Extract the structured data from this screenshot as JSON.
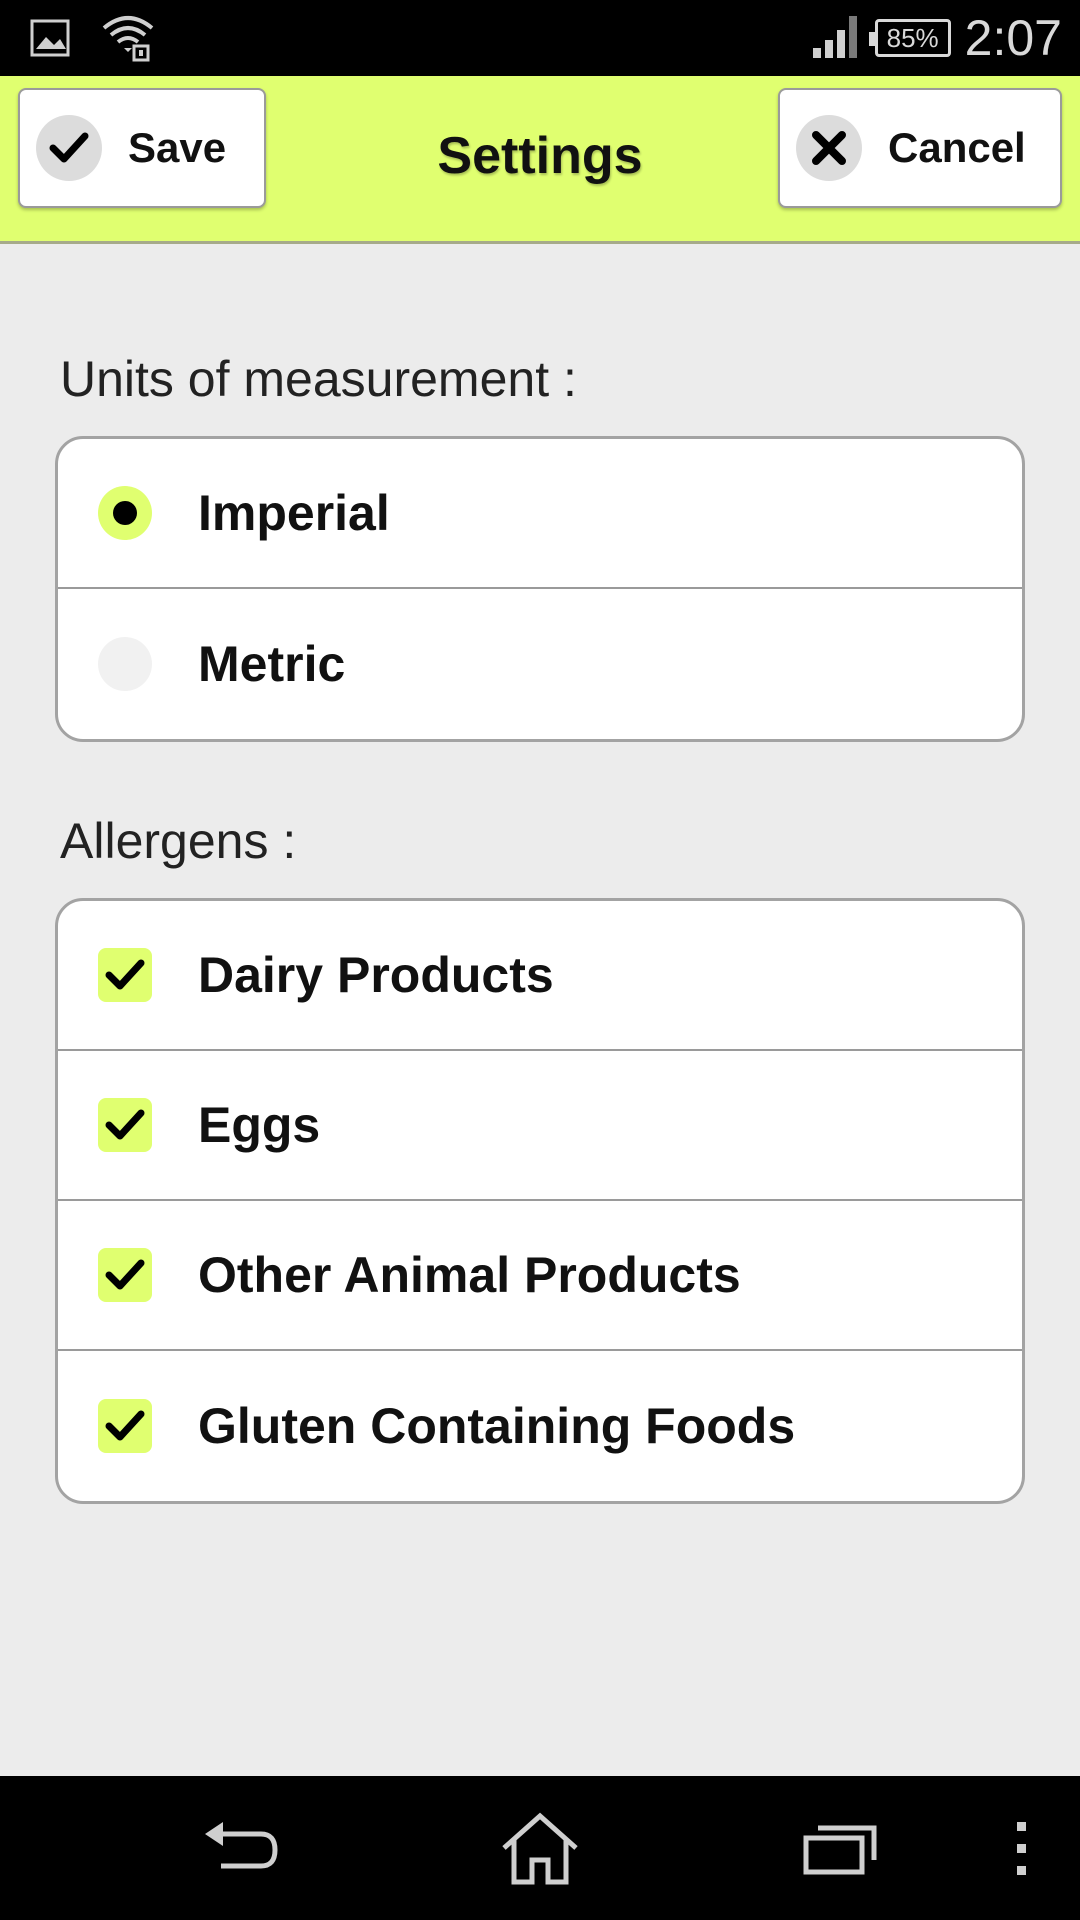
{
  "status_bar": {
    "battery": "85%",
    "time": "2:07",
    "icons": [
      "gallery-icon",
      "wifi-icon",
      "signal-icon",
      "battery-icon"
    ]
  },
  "action_bar": {
    "title": "Settings",
    "save_label": "Save",
    "cancel_label": "Cancel",
    "accent_color": "#e0ff70"
  },
  "units": {
    "label": "Units of measurement :",
    "options": [
      {
        "label": "Imperial",
        "selected": true
      },
      {
        "label": "Metric",
        "selected": false
      }
    ]
  },
  "allergens": {
    "label": "Allergens :",
    "items": [
      {
        "label": "Dairy Products",
        "checked": true
      },
      {
        "label": "Eggs",
        "checked": true
      },
      {
        "label": "Other Animal Products",
        "checked": true
      },
      {
        "label": "Gluten Containing Foods",
        "checked": true
      }
    ]
  },
  "nav_bar": {
    "icons": [
      "back-icon",
      "home-icon",
      "recent-apps-icon",
      "overflow-menu-icon"
    ]
  }
}
